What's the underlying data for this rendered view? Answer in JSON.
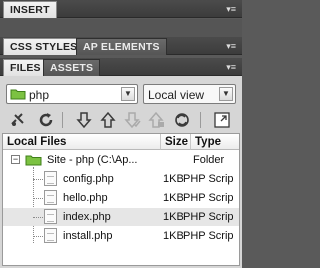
{
  "panels": {
    "insert": {
      "label": "INSERT"
    },
    "css": {
      "tab1": "CSS STYLES",
      "tab2": "AP ELEMENTS"
    },
    "files": {
      "tab1": "FILES",
      "tab2": "ASSETS"
    }
  },
  "site_selector": {
    "value": "php"
  },
  "view_selector": {
    "value": "Local view"
  },
  "toolbar_icons": [
    "connect-icon",
    "refresh-icon",
    "get-icon",
    "put-icon",
    "checkout-icon",
    "checkin-icon",
    "sync-icon",
    "expand-icon"
  ],
  "table": {
    "headers": {
      "name": "Local Files",
      "size": "Size",
      "type": "Type"
    },
    "site_row": {
      "name": "Site - php (C:\\Ap...",
      "size": "",
      "type": "Folder"
    },
    "rows": [
      {
        "name": "config.php",
        "size": "1KB",
        "type": "PHP Scrip"
      },
      {
        "name": "hello.php",
        "size": "1KB",
        "type": "PHP Scrip"
      },
      {
        "name": "index.php",
        "size": "1KB",
        "type": "PHP Scrip"
      },
      {
        "name": "install.php",
        "size": "1KB",
        "type": "PHP Scrip"
      }
    ],
    "selected_row": 2
  }
}
